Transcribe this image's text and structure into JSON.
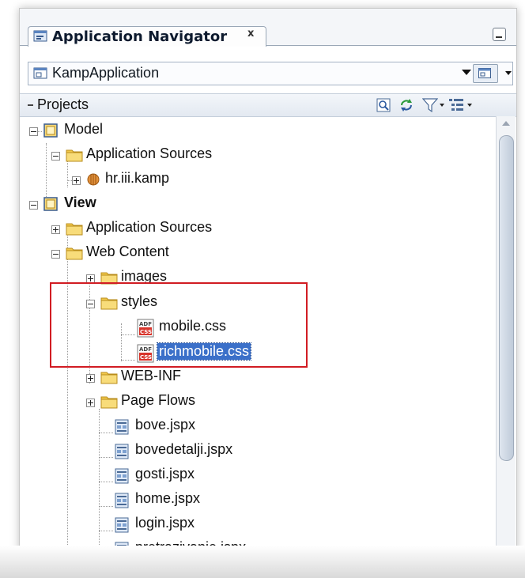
{
  "tab": {
    "title": "Application Navigator",
    "close_label": "x"
  },
  "app_selector": {
    "value": "KampApplication"
  },
  "projects_panel": {
    "title": "Projects"
  },
  "toolbar": {
    "icons": [
      "find-icon",
      "sync-icon",
      "filter-icon",
      "sort-options-icon"
    ]
  },
  "tree": {
    "model": {
      "label": "Model"
    },
    "model_app_sources": {
      "label": "Application Sources"
    },
    "model_package": {
      "label": "hr.iii.kamp"
    },
    "view": {
      "label": "View"
    },
    "view_app_sources": {
      "label": "Application Sources"
    },
    "web_content": {
      "label": "Web Content"
    },
    "images": {
      "label": "images"
    },
    "styles": {
      "label": "styles"
    },
    "mobile_css": {
      "label": "mobile.css",
      "badge_top": "ADF",
      "badge_bottom": "CSS"
    },
    "richmobile_css": {
      "label": "richmobile.css",
      "badge_top": "ADF",
      "badge_bottom": "CSS"
    },
    "web_inf": {
      "label": "WEB-INF"
    },
    "page_flows": {
      "label": "Page Flows"
    },
    "files": [
      {
        "label": "bove.jspx"
      },
      {
        "label": "bovedetalji.jspx"
      },
      {
        "label": "gosti.jspx"
      },
      {
        "label": "home.jspx"
      },
      {
        "label": "login.jspx"
      },
      {
        "label": "pretrazivanje.jspx"
      }
    ]
  },
  "colors": {
    "selection": "#3b70c9",
    "highlight_box": "#d11c23",
    "folder": "#f2c94c"
  }
}
